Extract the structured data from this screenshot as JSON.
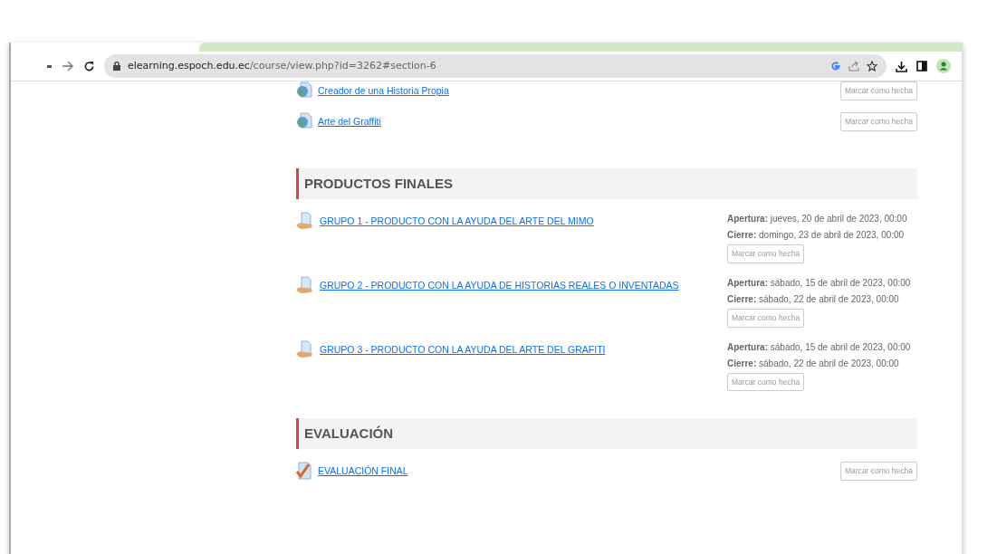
{
  "browser": {
    "url_host": "elearning.espoch.edu.ec",
    "url_path": "/course/view.php?id=3262#section-6"
  },
  "sections": [
    {
      "items": [
        {
          "kind": "url",
          "label": "Creador de una Historia Propia",
          "button": "Marcar como hecha"
        },
        {
          "kind": "url",
          "label": "Arte del Graffiti",
          "button": "Marcar como hecha"
        }
      ]
    },
    {
      "title": "PRODUCTOS FINALES",
      "items": [
        {
          "kind": "assignment",
          "label": "GRUPO 1 - PRODUCTO CON LA AYUDA DEL ARTE DEL MIMO",
          "dates": [
            {
              "label": "Apertura:",
              "value": "jueves, 20 de abril de 2023, 00:00"
            },
            {
              "label": "Cierre:",
              "value": "domingo, 23 de abril de 2023, 00:00"
            }
          ],
          "button": "Marcar como hecha"
        },
        {
          "kind": "assignment",
          "label": "GRUPO 2 - PRODUCTO CON LA AYUDA DE HISTORIAS REALES O INVENTADAS",
          "dates": [
            {
              "label": "Apertura:",
              "value": "sábado, 15 de abril de 2023, 00:00"
            },
            {
              "label": "Cierre:",
              "value": "sábado, 22 de abril de 2023, 00:00"
            }
          ],
          "button": "Marcar como hecha"
        },
        {
          "kind": "assignment",
          "label": "GRUPO 3 - PRODUCTO CON LA AYUDA DEL ARTE DEL GRAFITI",
          "dates": [
            {
              "label": "Apertura:",
              "value": "sábado, 15 de abril de 2023, 00:00"
            },
            {
              "label": "Cierre:",
              "value": "sábado, 22 de abril de 2023, 00:00"
            }
          ],
          "button": "Marcar como hecha"
        }
      ]
    },
    {
      "title": "EVALUACIÓN",
      "items": [
        {
          "kind": "quiz",
          "label": "EVALUACIÓN FINAL",
          "button": "Marcar como hecha"
        }
      ]
    }
  ]
}
